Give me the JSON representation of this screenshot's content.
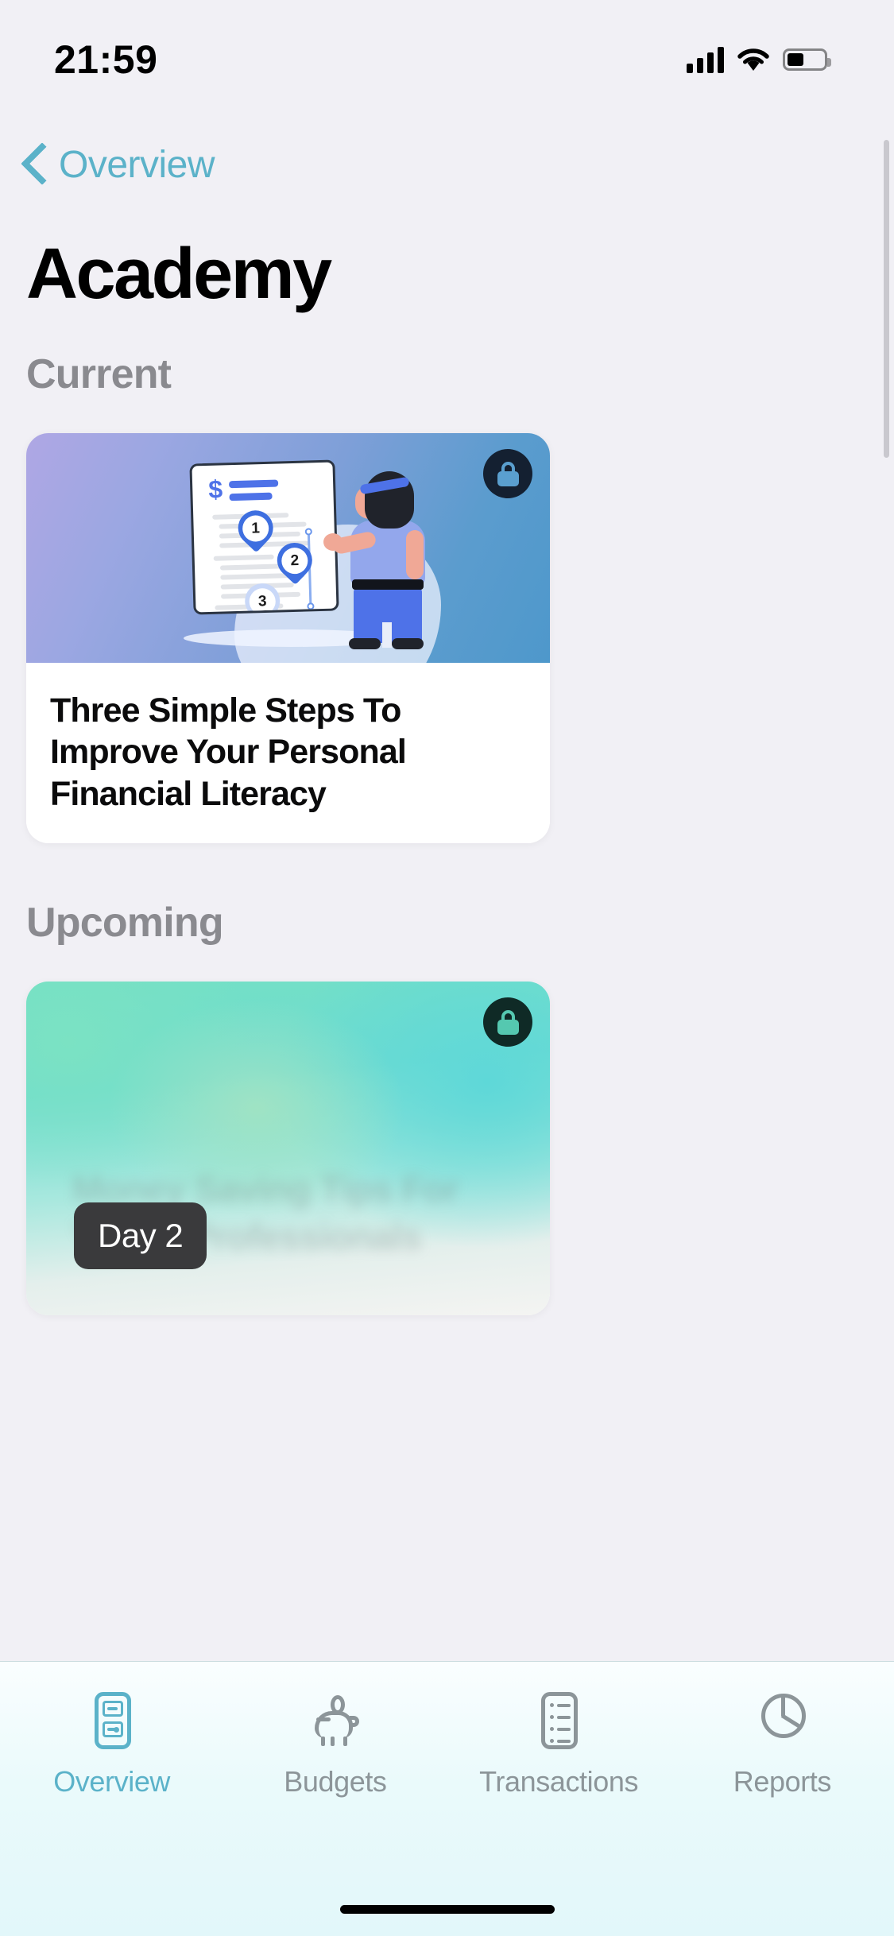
{
  "status_bar": {
    "time": "21:59",
    "signal_icon": "cellular-signal-icon",
    "wifi_icon": "wifi-icon",
    "battery_icon": "battery-icon"
  },
  "nav": {
    "back_label": "Overview",
    "back_icon": "chevron-left-icon",
    "accent_color": "#5BB2C9"
  },
  "page": {
    "title": "Academy"
  },
  "sections": [
    {
      "heading": "Current"
    },
    {
      "heading": "Upcoming"
    }
  ],
  "current_card": {
    "title": "Three Simple Steps To Improve Your Personal Financial Literacy",
    "locked": true,
    "lock_icon": "lock-icon",
    "illustration": {
      "name": "woman-presenting-whiteboard-illustration",
      "dollar_symbol": "$",
      "steps": [
        "1",
        "2",
        "3"
      ]
    },
    "gradient_start": "#AFA7E4",
    "gradient_end": "#4E98CB"
  },
  "upcoming_card": {
    "blurred_title": "Money Saving Tips For Young Professionals",
    "day_badge": "Day 2",
    "locked": true,
    "lock_icon": "lock-icon",
    "gradient_start": "#74E0C5",
    "gradient_end": "#F4F4F2"
  },
  "tabbar": {
    "items": [
      {
        "label": "Overview",
        "icon": "overview-icon",
        "active": true
      },
      {
        "label": "Budgets",
        "icon": "piggy-bank-icon",
        "active": false
      },
      {
        "label": "Transactions",
        "icon": "list-icon",
        "active": false
      },
      {
        "label": "Reports",
        "icon": "pie-chart-icon",
        "active": false
      }
    ],
    "active_color": "#5BB2C9",
    "inactive_color": "#8C9599"
  }
}
